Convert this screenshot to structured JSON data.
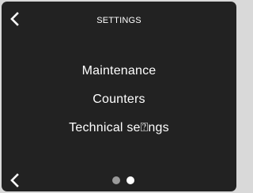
{
  "header": {
    "title": "SETTINGS",
    "back_icon": "chevron-left-icon"
  },
  "menu": {
    "items": [
      {
        "label": "Maintenance"
      },
      {
        "label": "Counters"
      },
      {
        "label": "Technical se⍰ngs"
      }
    ]
  },
  "footer": {
    "back_icon": "chevron-left-icon",
    "pager": {
      "total": 2,
      "current": 2
    }
  },
  "colors": {
    "background": "#222222",
    "text": "#ffffff",
    "dot_inactive": "#9a9a9a",
    "dot_active": "#ffffff"
  }
}
